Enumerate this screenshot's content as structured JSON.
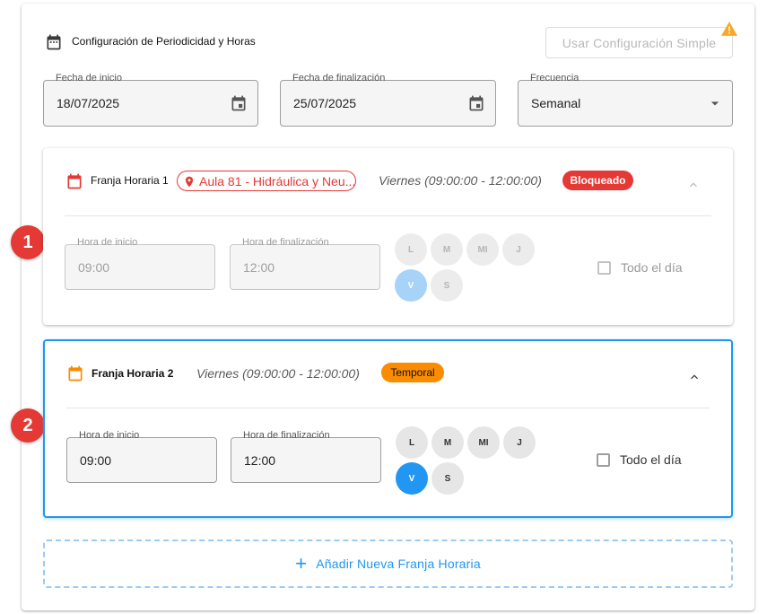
{
  "header": {
    "title": "Configuración de Periodicidad y Horas",
    "simple_button": "Usar Configuración Simple"
  },
  "dates": {
    "start_label": "Fecha de inicio",
    "start_value": "18/07/2025",
    "end_label": "Fecha de finalización",
    "end_value": "25/07/2025",
    "frequency_label": "Frecuencia",
    "frequency_value": "Semanal"
  },
  "franjas": [
    {
      "title": "Franja Horaria 1",
      "location": "Aula 81 - Hidráulica y Neu...",
      "schedule": "Viernes (09:00:00 - 12:00:00)",
      "badge": "Bloqueado",
      "start_label": "Hora de inicio",
      "start_value": "09:00",
      "end_label": "Hora de finalización",
      "end_value": "12:00",
      "days": [
        "L",
        "M",
        "MI",
        "J",
        "V",
        "S"
      ],
      "selected_day": "V",
      "all_day_label": "Todo el día",
      "all_day": false,
      "disabled": true
    },
    {
      "title": "Franja Horaria 2",
      "schedule": "Viernes (09:00:00 - 12:00:00)",
      "badge": "Temporal",
      "start_label": "Hora de inicio",
      "start_value": "09:00",
      "end_label": "Hora de finalización",
      "end_value": "12:00",
      "days": [
        "L",
        "M",
        "MI",
        "J",
        "V",
        "S"
      ],
      "selected_day": "V",
      "all_day_label": "Todo el día",
      "all_day": false,
      "disabled": false
    }
  ],
  "markers": [
    "1",
    "2"
  ],
  "add_button": "Añadir Nueva Franja Horaria",
  "icons": {
    "header": "calendar-icon",
    "date_picker": "calendar-icon",
    "dropdown": "caret-down-icon",
    "warning": "warning-icon",
    "location": "map-pin-icon",
    "collapse": "chevron-up-icon",
    "add": "plus-icon"
  },
  "colors": {
    "accent": "#2196f3",
    "danger": "#e53935",
    "warning": "#fb8c00",
    "warning_icon": "#f9a825"
  }
}
